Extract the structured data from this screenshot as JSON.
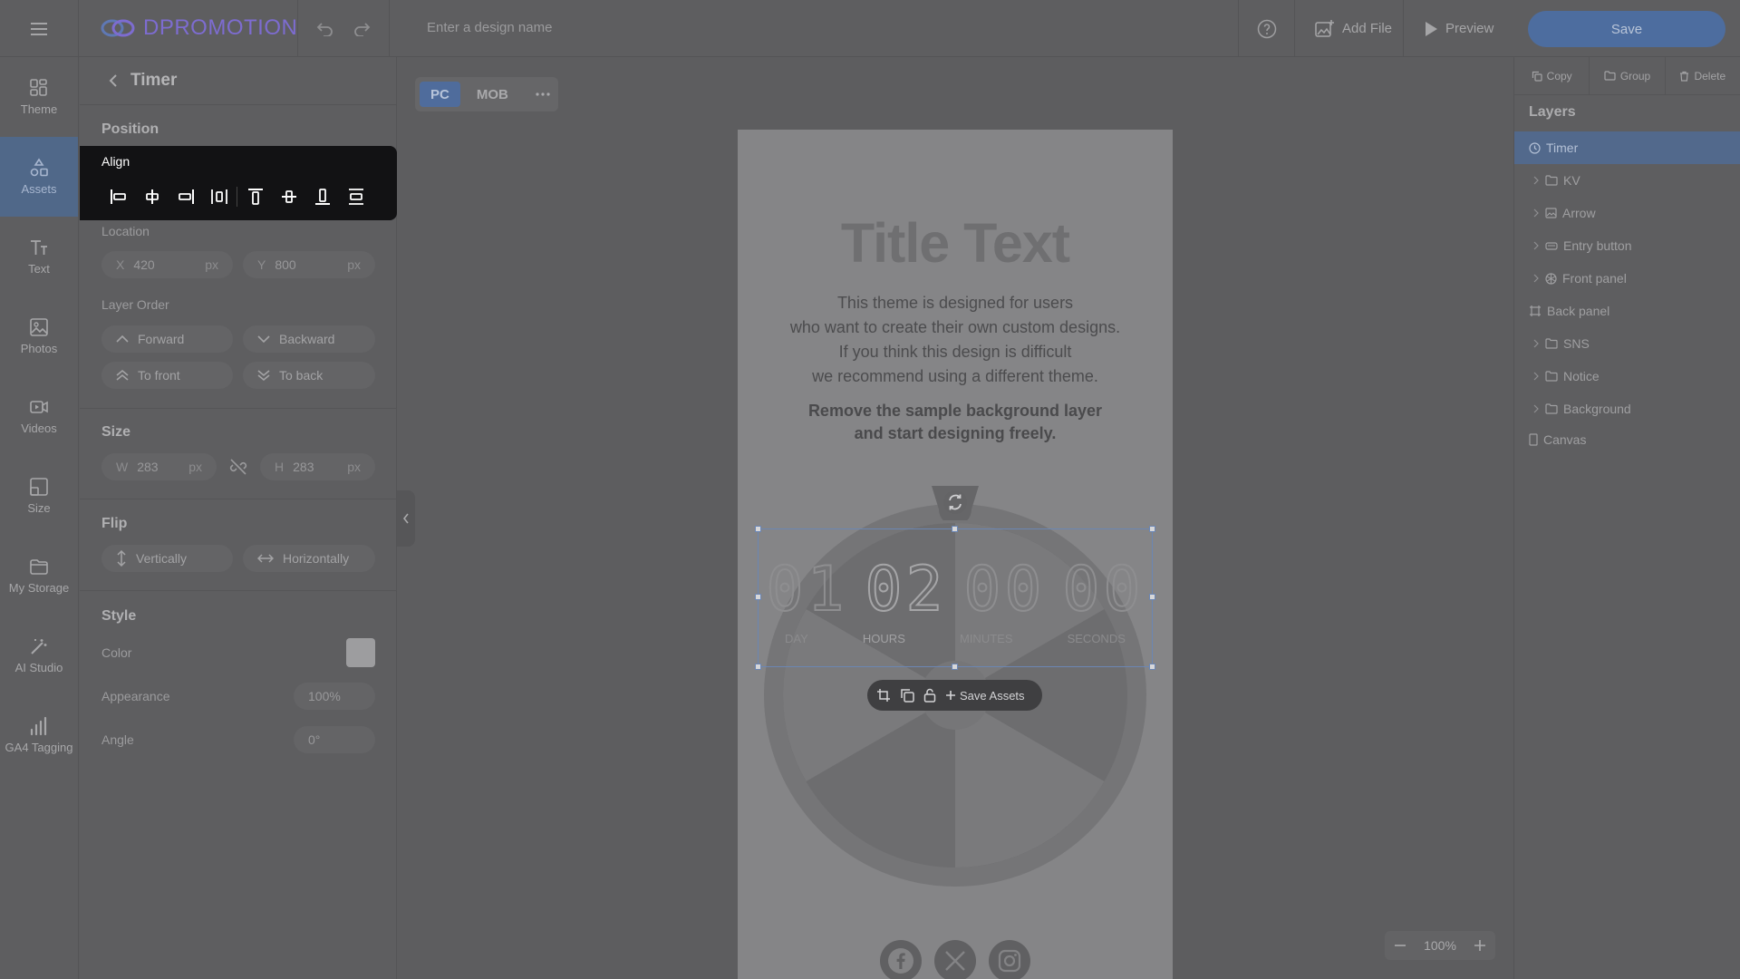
{
  "app": {
    "logo_text": "DPROMOTION",
    "design_name_placeholder": "Enter a design name",
    "add_file": "Add File",
    "preview": "Preview",
    "save": "Save",
    "brand_color": "#7d6cd0",
    "accent_color": "#4d6d9f"
  },
  "rail": {
    "items": [
      {
        "label": "Theme",
        "icon": "theme-icon"
      },
      {
        "label": "Assets",
        "icon": "assets-icon",
        "active": true
      },
      {
        "label": "Text",
        "icon": "text-icon"
      },
      {
        "label": "Photos",
        "icon": "photos-icon"
      },
      {
        "label": "Videos",
        "icon": "videos-icon"
      },
      {
        "label": "Size",
        "icon": "size-icon"
      },
      {
        "label": "My Storage",
        "icon": "folder-icon"
      },
      {
        "label": "AI Studio",
        "icon": "magic-wand-icon"
      },
      {
        "label": "GA4 Tagging",
        "icon": "bar-chart-icon"
      }
    ]
  },
  "panel": {
    "title": "Timer",
    "position": {
      "title": "Position",
      "align_label": "Align",
      "location_label": "Location",
      "x_prefix": "X",
      "x_value": "420",
      "y_prefix": "Y",
      "y_value": "800",
      "unit": "px",
      "layer_order_label": "Layer Order",
      "forward": "Forward",
      "backward": "Backward",
      "to_front": "To front",
      "to_back": "To back"
    },
    "size": {
      "title": "Size",
      "w_prefix": "W",
      "w_value": "283",
      "h_prefix": "H",
      "h_value": "283",
      "unit": "px"
    },
    "flip": {
      "title": "Flip",
      "vertically": "Vertically",
      "horizontally": "Horizontally"
    },
    "style": {
      "title": "Style",
      "color_label": "Color",
      "color_value": "#9d9d9f",
      "appearance_label": "Appearance",
      "appearance_value": "100%",
      "angle_label": "Angle",
      "angle_value": "0°"
    }
  },
  "canvas": {
    "tabs": [
      "PC",
      "MOB"
    ],
    "active_tab": "PC",
    "title": "Title Text",
    "desc_lines": [
      "This theme is designed for users",
      "who want to create their own custom designs.",
      "If you think this design is difficult",
      "we recommend using a different theme."
    ],
    "bold_lines": [
      "Remove the sample background layer",
      "and start designing freely."
    ],
    "timer": {
      "digits": [
        "01",
        "02",
        "00",
        "00"
      ],
      "labels": [
        "DAY",
        "HOURS",
        "MINUTES",
        "SECONDS"
      ]
    },
    "float_toolbar": {
      "save_assets": "Save Assets"
    },
    "zoom": "100%"
  },
  "right": {
    "copy": "Copy",
    "group": "Group",
    "delete": "Delete",
    "layers_title": "Layers",
    "layers": [
      {
        "label": "Timer",
        "icon": "clock-icon",
        "active": true,
        "expandable": false
      },
      {
        "label": "KV",
        "icon": "folder-icon",
        "expandable": true
      },
      {
        "label": "Arrow",
        "icon": "image-icon",
        "expandable": true
      },
      {
        "label": "Entry button",
        "icon": "button-icon",
        "expandable": true
      },
      {
        "label": "Front panel",
        "icon": "wheel-icon",
        "expandable": true
      },
      {
        "label": "Back panel",
        "icon": "frame-icon",
        "expandable": false
      },
      {
        "label": "SNS",
        "icon": "folder-icon",
        "expandable": true
      },
      {
        "label": "Notice",
        "icon": "folder-icon",
        "expandable": true
      },
      {
        "label": "Background",
        "icon": "folder-icon",
        "expandable": true
      },
      {
        "label": "Canvas",
        "icon": "page-icon",
        "expandable": false
      }
    ]
  }
}
